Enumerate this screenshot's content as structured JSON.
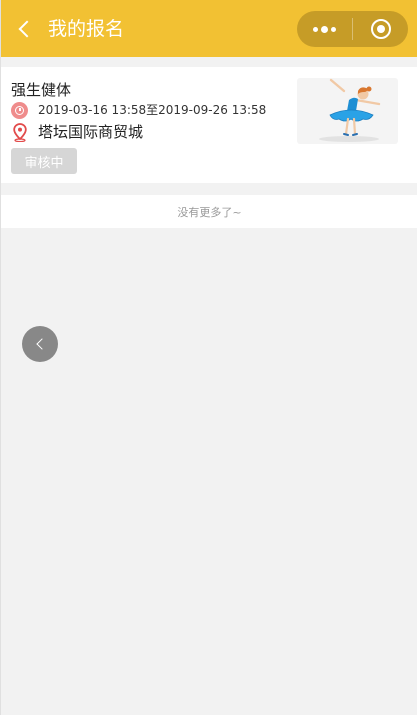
{
  "navbar": {
    "title": "我的报名",
    "back_icon": "chevron-left-icon",
    "more_icon": "more-dots-icon",
    "close_icon": "target-icon",
    "color": "#f2c133"
  },
  "card": {
    "title": "强生健体",
    "time_icon": "clock-icon",
    "time_range": "2019-03-16 13:58至2019-09-26 13:58",
    "location_icon": "location-pin-icon",
    "location": "塔坛国际商贸城",
    "status": "审核中",
    "thumbnail_icon": "ballerina-illustration"
  },
  "footer": {
    "no_more": "没有更多了~"
  },
  "float_back_icon": "chevron-left-icon"
}
